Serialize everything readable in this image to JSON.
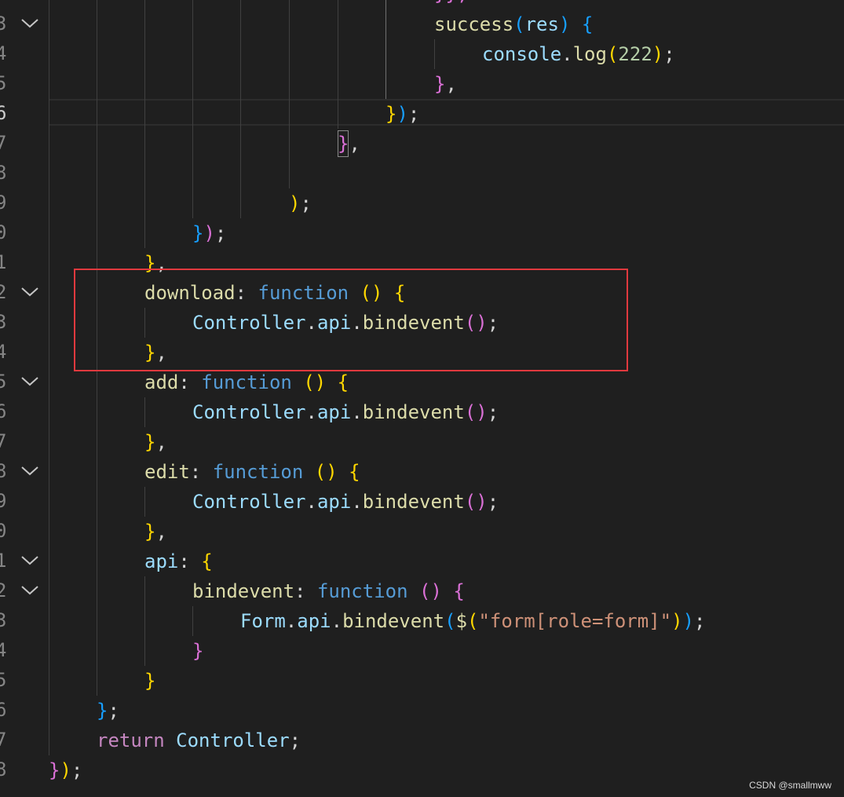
{
  "gutter": {
    "line_digits": [
      "",
      "3",
      "4",
      "5",
      "6",
      "7",
      "8",
      "9",
      "0",
      "1",
      "2",
      "3",
      "4",
      "5",
      "6",
      "7",
      "8",
      "9",
      "0",
      "1",
      "2",
      "3",
      "4",
      "5",
      "6",
      "7",
      "8"
    ],
    "active_index": 4
  },
  "code": {
    "top_partial": "}};",
    "l1_prop": "success",
    "l1_param": "res",
    "l2_obj": "console",
    "l2_fn": "log",
    "l2_num": "222",
    "l12_prop": "download",
    "l12_kw": "function",
    "ctl": "Controller",
    "api": "api",
    "bindevent": "bindevent",
    "l15_prop": "add",
    "l18_prop": "edit",
    "l21_prop": "api",
    "l22_prop": "bindevent",
    "form": "Form",
    "dollar": "$",
    "selector": "\"form[role=form]\"",
    "return_kw": "return"
  },
  "watermark": "CSDN @smallmww",
  "colors": {
    "background": "#1f1f1f",
    "highlight_box": "#e0393e",
    "keyword": "#569cd6",
    "property": "#dcdcaa",
    "variable": "#9cdcfe",
    "string": "#ce9178",
    "number": "#b5cea8",
    "control": "#c586c0",
    "bracket_gold": "#ffd700",
    "bracket_orchid": "#da70d6",
    "bracket_blue": "#179fff"
  },
  "icons": {
    "fold": "chevron-down-icon"
  }
}
